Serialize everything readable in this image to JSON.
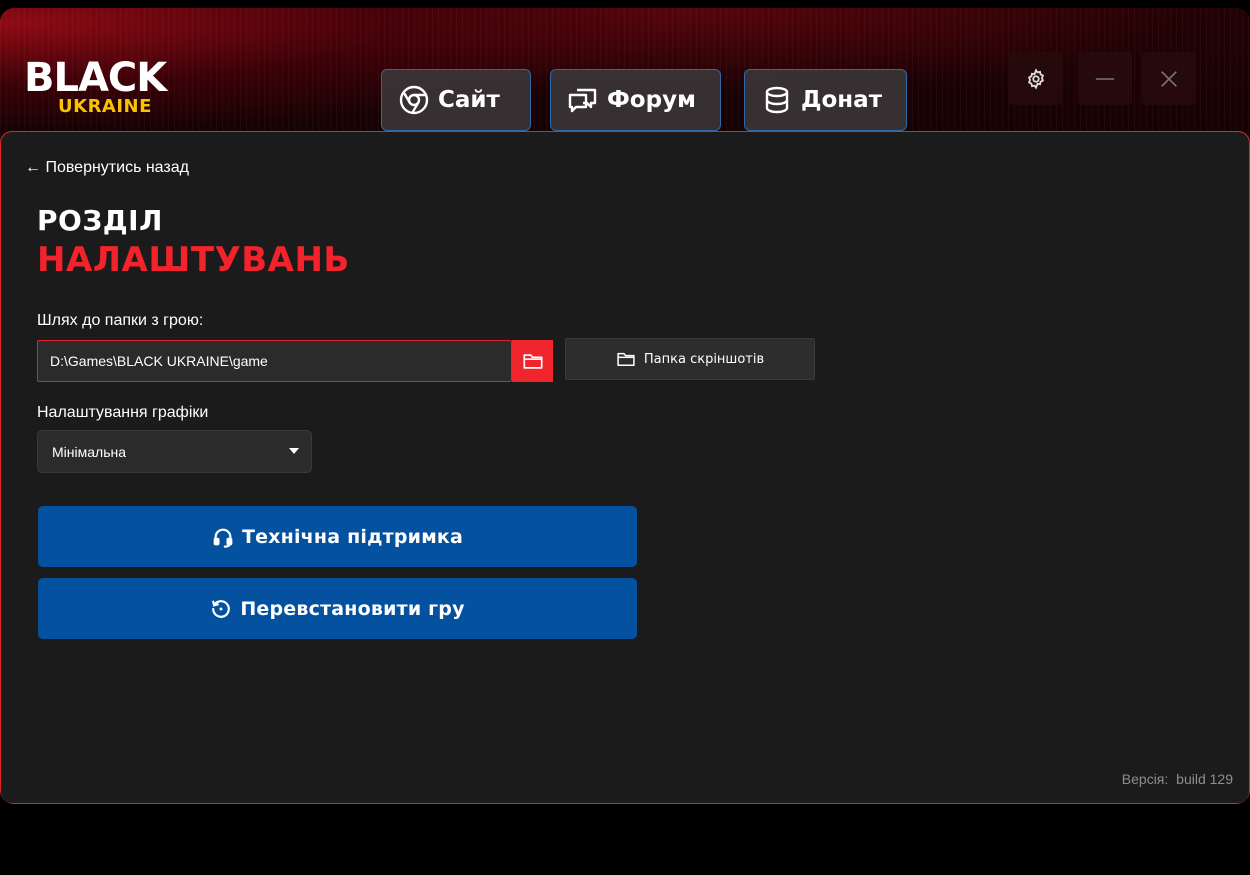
{
  "brand": {
    "logo_main": "BLACK",
    "logo_sub": "UKRAINE",
    "colors": {
      "accent_red": "#e0242c",
      "logo_yellow": "#f7c400",
      "button_blue": "#0451a0"
    }
  },
  "nav": {
    "site": {
      "label": "Сайт",
      "icon": "chrome-icon"
    },
    "forum": {
      "label": "Форум",
      "icon": "chat-icon"
    },
    "donate": {
      "label": "Донат",
      "icon": "database-icon"
    }
  },
  "window_controls": {
    "settings_icon": "gear-icon",
    "minimize_icon": "minimize-icon",
    "close_icon": "close-icon"
  },
  "settings": {
    "back_link": "← Повернутись назад",
    "title_line1": "РОЗДІЛ",
    "title_line2": "НАЛАШТУВАНЬ",
    "path_label": "Шлях до папки з грою:",
    "path_value": "D:\\Games\\BLACK UKRAINE\\game",
    "screenshots_button": "Папка скріншотів",
    "graphics_label": "Налаштування графіки",
    "graphics_selected": "Мінімальна",
    "support_button": "Технічна підтримка",
    "reinstall_button": "Перевстановити гру",
    "version_label": "Версія:",
    "version_value": "build 129"
  }
}
